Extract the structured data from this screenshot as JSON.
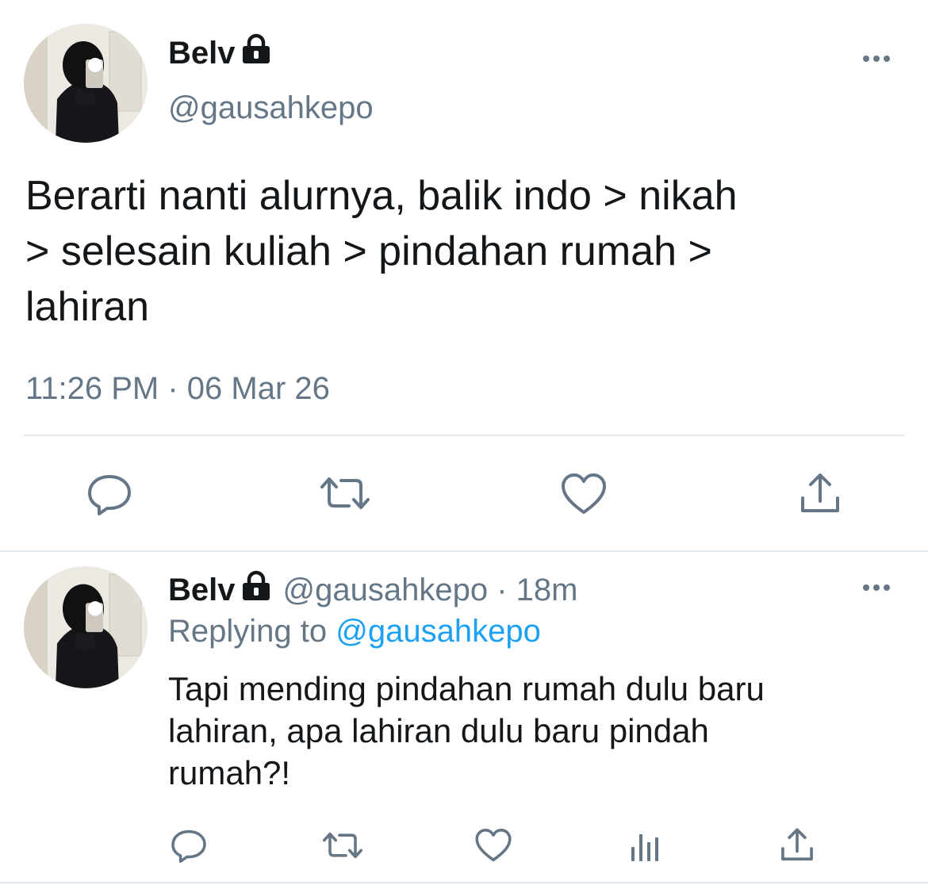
{
  "tweet": {
    "display_name": "Belv",
    "handle": "@gausahkepo",
    "text_lines": [
      "Berarti nanti alurnya, balik indo > nikah",
      "> selesain kuliah > pindahan rumah >",
      "lahiran"
    ],
    "timestamp": "11:26 PM · 06 Mar 26",
    "protected_icon": "lock-icon",
    "actions": [
      "reply-icon",
      "retweet-icon",
      "like-icon",
      "share-icon"
    ]
  },
  "reply": {
    "display_name": "Belv",
    "handle_time": "@gausahkepo · 18m",
    "replying_prefix": "Replying to",
    "replying_to": "@gausahkepo",
    "text_lines": [
      "Tapi mending pindahan rumah dulu baru",
      "lahiran, apa lahiran dulu baru pindah",
      "rumah?!"
    ],
    "actions": [
      "reply-icon",
      "retweet-icon",
      "like-icon",
      "analytics-icon",
      "share-icon"
    ]
  },
  "colors": {
    "text": "#14171a",
    "muted": "#657786",
    "link": "#1da1f2",
    "divider": "#e1e8ed"
  }
}
